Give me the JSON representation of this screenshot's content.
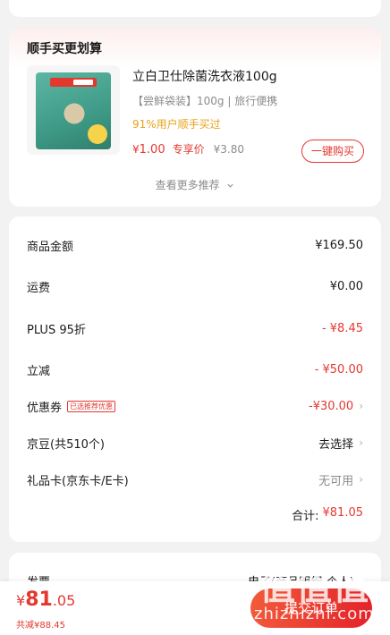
{
  "recommend": {
    "title": "顺手买更划算",
    "product": {
      "name": "立白卫仕除菌洗衣液100g",
      "spec": "【尝鲜袋装】100g | 旅行便携",
      "stat": "91%用户顺手买过",
      "price_symbol": "¥",
      "price": "1.00",
      "price_tag": "专享价",
      "original_price": "¥3.80",
      "buy_label": "一键购买"
    },
    "more_label": "查看更多推荐",
    "more_icon": "chevron-down-icon"
  },
  "pricing": {
    "rows": [
      {
        "label": "商品金额",
        "value": "¥169.50"
      },
      {
        "label": "运费",
        "value": "¥0.00"
      },
      {
        "label": "PLUS 95折",
        "value": "- ¥8.45"
      },
      {
        "label": "立减",
        "value": "- ¥50.00"
      },
      {
        "label": "优惠券",
        "tag": "已选推荐优惠",
        "value": "-¥30.00"
      },
      {
        "label": "京豆(共510个)",
        "value": "去选择"
      },
      {
        "label": "礼品卡(京东卡/E卡)",
        "value": "无可用"
      }
    ],
    "total_label": "合计:",
    "total_value": "¥81.05"
  },
  "invoice": {
    "label": "发票",
    "value": "电子(商品明细-个人)"
  },
  "bottom": {
    "symbol": "¥",
    "int": "81",
    "dec": ".05",
    "saved": "共减¥88.45",
    "submit_label": "提交订单"
  },
  "watermark": {
    "big": "值值值",
    "small": "zhizhizhi.com"
  },
  "colors": {
    "accent": "#e4382f",
    "price_gold": "#e8a21a",
    "background": "#f2f2f2"
  }
}
